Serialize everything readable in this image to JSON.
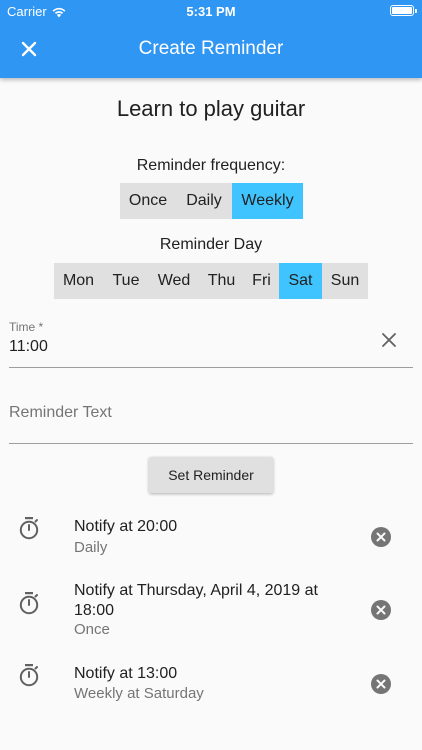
{
  "status_bar": {
    "carrier": "Carrier",
    "time": "5:31 PM"
  },
  "appbar": {
    "title": "Create Reminder"
  },
  "goal": {
    "title": "Learn to play guitar"
  },
  "frequency": {
    "label": "Reminder frequency:",
    "options": [
      "Once",
      "Daily",
      "Weekly"
    ],
    "selected": "Weekly"
  },
  "day": {
    "label": "Reminder Day",
    "options": [
      "Mon",
      "Tue",
      "Wed",
      "Thu",
      "Fri",
      "Sat",
      "Sun"
    ],
    "selected": "Sat"
  },
  "time_field": {
    "label": "Time *",
    "value": "11:00"
  },
  "text_field": {
    "placeholder": "Reminder Text"
  },
  "set_button": {
    "label": "Set Reminder"
  },
  "reminders": [
    {
      "title": "Notify at 20:00",
      "subtitle": "Daily"
    },
    {
      "title": "Notify at Thursday, April 4, 2019 at 18:00",
      "subtitle": "Once"
    },
    {
      "title": "Notify at 13:00",
      "subtitle": "Weekly at Saturday"
    }
  ],
  "colors": {
    "appbar": "#2f96f3",
    "selected": "#40c4ff",
    "segment_bg": "#e0e0e0"
  }
}
